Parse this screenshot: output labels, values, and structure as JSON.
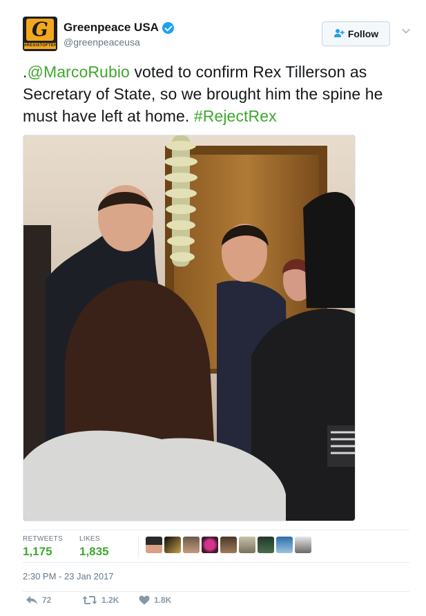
{
  "account": {
    "display_name": "Greenpeace USA",
    "handle": "@greenpeaceusa",
    "avatar_letter": "G",
    "avatar_tag": "#RESISTOFTEN"
  },
  "follow_label": "Follow",
  "tweet": {
    "prefix": ".",
    "mention": "@MarcoRubio",
    "body": " voted to confirm Rex Tillerson as Secretary of State, so we brought him the spine he must have left at home. ",
    "hashtag": "#RejectRex"
  },
  "stats": {
    "retweets_label": "RETWEETS",
    "retweets_value": "1,175",
    "likes_label": "LIKES",
    "likes_value": "1,835"
  },
  "timestamp": "2:30 PM - 23 Jan 2017",
  "actions": {
    "reply_count": "72",
    "retweet_count": "1.2K",
    "like_count": "1.8K"
  },
  "colors": {
    "link": "#3ea72d",
    "verified": "#1da1f2",
    "muted": "#657786",
    "action": "#8899a6"
  },
  "icons": [
    "verified-icon",
    "follow-icon",
    "chevron-down-icon",
    "reply-icon",
    "retweet-icon",
    "heart-icon"
  ]
}
